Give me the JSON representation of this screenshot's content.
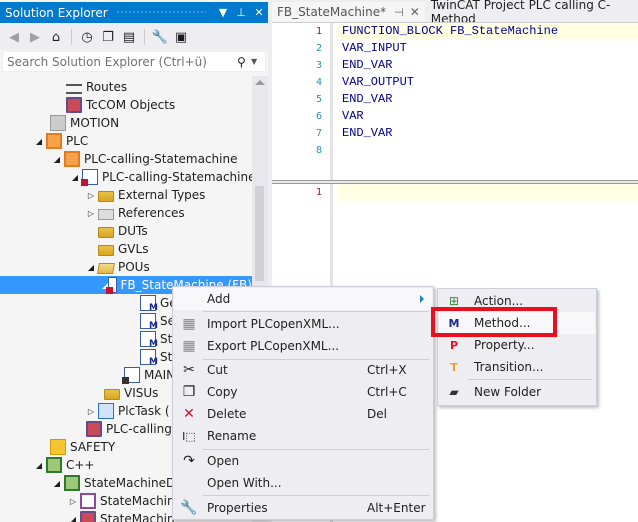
{
  "solution_explorer": {
    "title": "Solution Explorer",
    "title_buttons": {
      "dropdown": "▼",
      "pin": "⊥",
      "close": "✕"
    },
    "toolbar_icons": [
      "back-icon",
      "forward-icon",
      "home-icon",
      "pending-changes-icon",
      "collapse-all-icon",
      "show-all-files-icon",
      "properties-icon",
      "preview-icon"
    ],
    "search_placeholder": "Search Solution Explorer (Ctrl+ü)",
    "tree": [
      {
        "label": "Routes",
        "icon": "routes-icon",
        "expander": ""
      },
      {
        "label": "TcCOM Objects",
        "icon": "tccom-icon",
        "expander": ""
      },
      {
        "label": "MOTION",
        "icon": "motion-icon",
        "expander": ""
      },
      {
        "label": "PLC",
        "icon": "plc-icon",
        "expander": "expanded"
      },
      {
        "label": "PLC-calling-Statemachine",
        "icon": "plc-project-icon",
        "expander": "expanded"
      },
      {
        "label": "PLC-calling-Statemachine Project",
        "icon": "plc-nested-project-icon",
        "expander": "expanded"
      },
      {
        "label": "External Types",
        "icon": "folder-icon",
        "expander": "collapsed"
      },
      {
        "label": "References",
        "icon": "references-icon",
        "expander": "collapsed"
      },
      {
        "label": "DUTs",
        "icon": "folder-icon",
        "expander": ""
      },
      {
        "label": "GVLs",
        "icon": "folder-icon",
        "expander": ""
      },
      {
        "label": "POUs",
        "icon": "folder-open-icon",
        "expander": "expanded"
      },
      {
        "label": "FB_StateMachine (FB)",
        "icon": "pou-icon",
        "expander": "expanded",
        "selected": true
      },
      {
        "label": "Ge",
        "icon": "method-icon",
        "expander": ""
      },
      {
        "label": "Se",
        "icon": "method-icon",
        "expander": ""
      },
      {
        "label": "St",
        "icon": "method-icon",
        "expander": ""
      },
      {
        "label": "St",
        "icon": "method-icon",
        "expander": ""
      },
      {
        "label": "MAIN",
        "icon": "program-icon",
        "expander": ""
      },
      {
        "label": "VISUs",
        "icon": "folder-icon",
        "expander": ""
      },
      {
        "label": "PlcTask (",
        "icon": "task-icon",
        "expander": "collapsed"
      },
      {
        "label": "PLC-calling-",
        "icon": "tccom-icon",
        "expander": ""
      },
      {
        "label": "SAFETY",
        "icon": "safety-icon",
        "expander": ""
      },
      {
        "label": "C++",
        "icon": "cpp-icon",
        "expander": "expanded"
      },
      {
        "label": "StateMachineDr",
        "icon": "cpp-project-icon",
        "expander": "expanded"
      },
      {
        "label": "StateMachin",
        "icon": "cpp-module-icon",
        "expander": "collapsed"
      },
      {
        "label": "StateMachin",
        "icon": "tccom-icon",
        "expander": "expanded"
      }
    ]
  },
  "editor": {
    "tabs": [
      {
        "label": "FB_StateMachine*",
        "active": true
      },
      {
        "label": "TwinCAT Project PLC calling C-Method",
        "active": false
      }
    ],
    "declaration_lines": [
      {
        "num": "1",
        "code": "FUNCTION_BLOCK FB_StateMachine"
      },
      {
        "num": "2",
        "code": "VAR_INPUT"
      },
      {
        "num": "3",
        "code": "END_VAR"
      },
      {
        "num": "4",
        "code": "VAR_OUTPUT"
      },
      {
        "num": "5",
        "code": "END_VAR"
      },
      {
        "num": "6",
        "code": "VAR"
      },
      {
        "num": "7",
        "code": "END_VAR"
      },
      {
        "num": "8",
        "code": ""
      }
    ],
    "implementation_lines": [
      {
        "num": "1",
        "code": ""
      }
    ]
  },
  "context_menu": {
    "items": [
      {
        "label": "Add",
        "shortcut": "",
        "icon": "",
        "submenu": true
      },
      {
        "label": "Import PLCopenXML...",
        "shortcut": "",
        "icon": "import-icon"
      },
      {
        "label": "Export PLCopenXML...",
        "shortcut": "",
        "icon": "export-icon"
      },
      {
        "label": "Cut",
        "shortcut": "Ctrl+X",
        "icon": "cut-icon"
      },
      {
        "label": "Copy",
        "shortcut": "Ctrl+C",
        "icon": "copy-icon"
      },
      {
        "label": "Delete",
        "shortcut": "Del",
        "icon": "delete-icon"
      },
      {
        "label": "Rename",
        "shortcut": "",
        "icon": "rename-icon"
      },
      {
        "label": "Open",
        "shortcut": "",
        "icon": "open-icon"
      },
      {
        "label": "Open With...",
        "shortcut": "",
        "icon": ""
      },
      {
        "label": "Properties",
        "shortcut": "Alt+Enter",
        "icon": "properties-icon"
      }
    ]
  },
  "submenu": {
    "items": [
      {
        "label": "Action...",
        "icon": "action-icon"
      },
      {
        "label": "Method...",
        "icon": "method-icon",
        "highlighted": true
      },
      {
        "label": "Property...",
        "icon": "property-icon"
      },
      {
        "label": "Transition...",
        "icon": "transition-icon"
      },
      {
        "label": "New Folder",
        "icon": "new-folder-icon"
      }
    ]
  },
  "colors": {
    "accent": "#007acc",
    "selection": "#3399ff",
    "highlight_box": "#e8101e",
    "keyword": "#00008b"
  }
}
